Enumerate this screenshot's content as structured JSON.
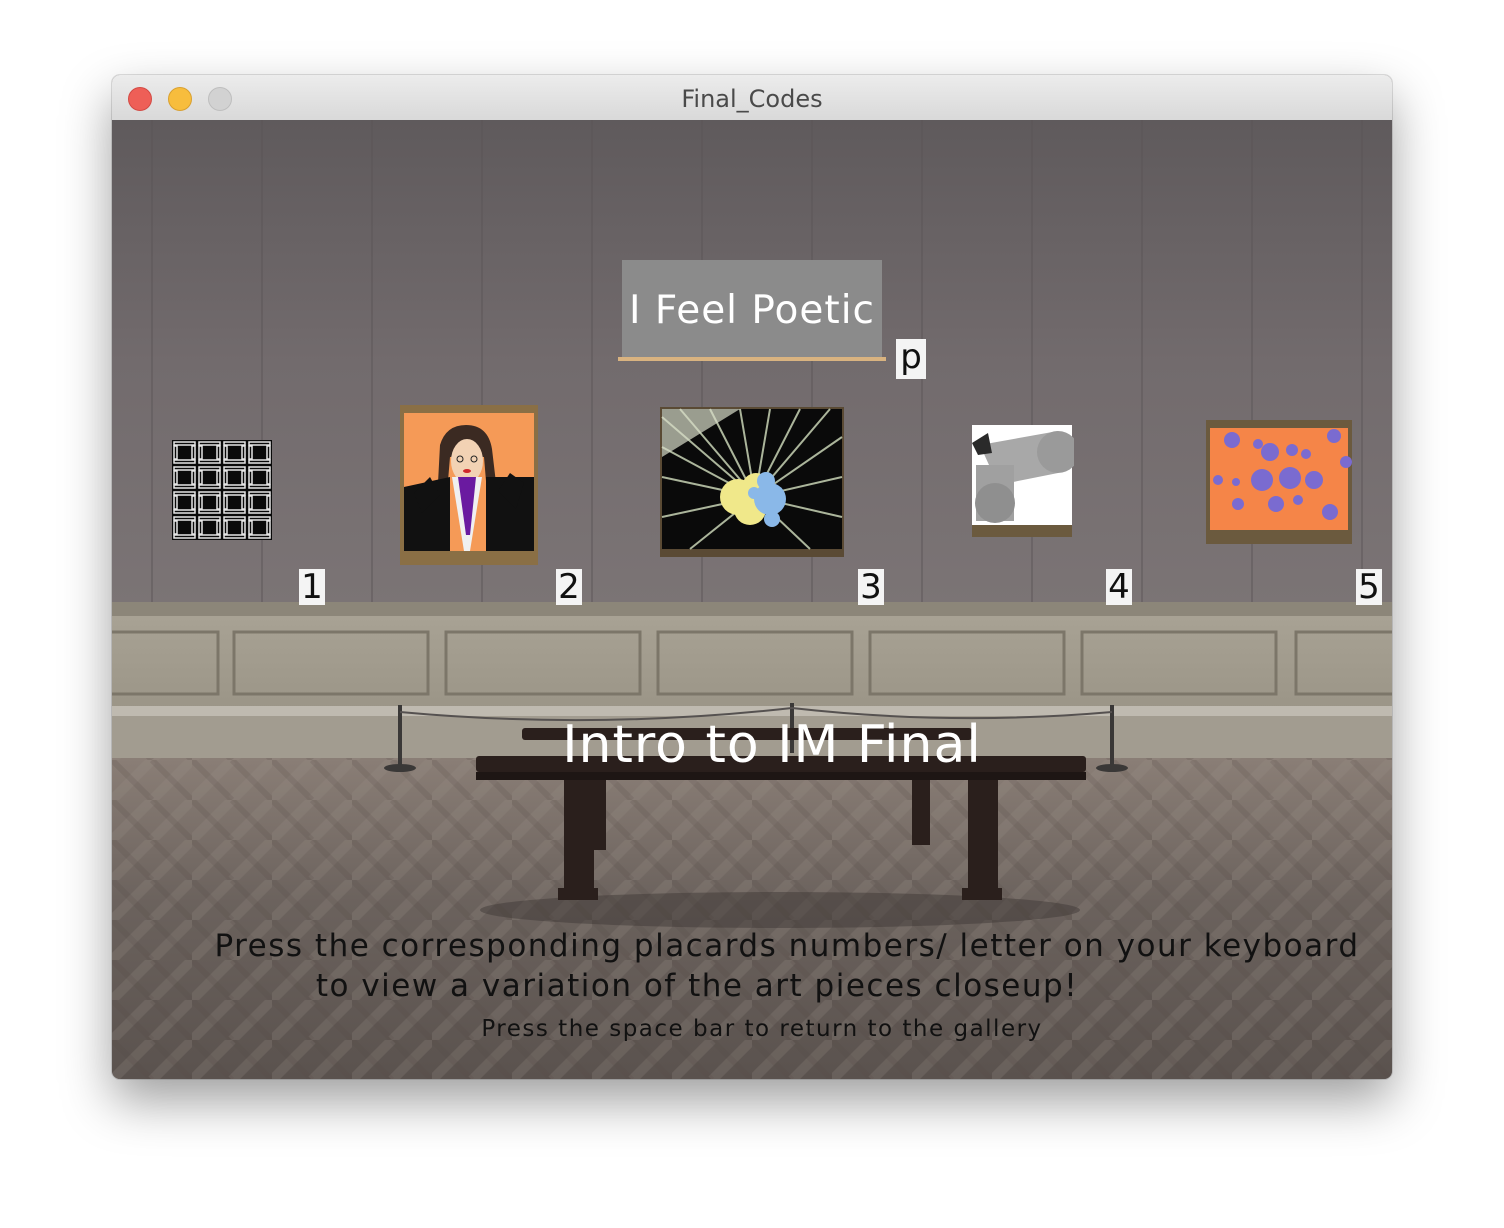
{
  "window": {
    "title": "Final_Codes"
  },
  "gallery": {
    "poetic_button": {
      "label": "I Feel Poetic",
      "key": "p"
    },
    "artworks": [
      {
        "placard": "1"
      },
      {
        "placard": "2"
      },
      {
        "placard": "3"
      },
      {
        "placard": "4"
      },
      {
        "placard": "5"
      }
    ],
    "heading": "Intro to IM Final",
    "instructions": {
      "line1": "Press the corresponding placards numbers/ letter on your keyboard",
      "line2": "to view a variation of the art pieces closeup!",
      "line3": "Press the space bar to return to the gallery"
    }
  },
  "colors": {
    "wall": "#706a6c",
    "poetic_box": "#8b8b8b",
    "poetic_underline": "#d9b380",
    "art2_background": "#f59a57",
    "art5_background": "#f58548",
    "art5_dots": "#7a6bd0"
  }
}
